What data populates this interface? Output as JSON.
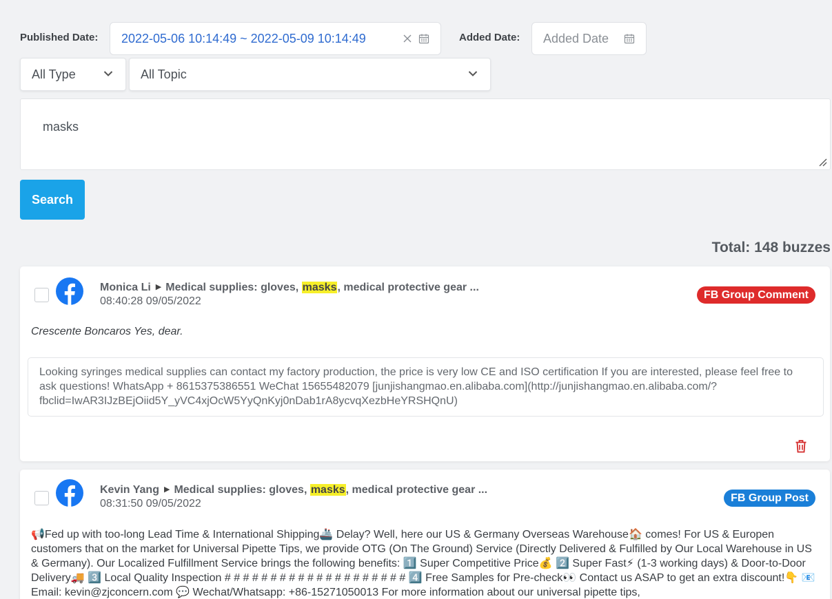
{
  "filters": {
    "published_label": "Published Date:",
    "published_value": "2022-05-06 10:14:49 ~ 2022-05-09 10:14:49",
    "added_label": "Added Date:",
    "added_placeholder": "Added Date",
    "type_value": "All Type",
    "topic_value": "All Topic",
    "search_text": "masks",
    "search_button": "Search"
  },
  "total_text": "Total: 148 buzzes",
  "colors": {
    "accent": "#1aa3e8",
    "fb_blue": "#1877f2",
    "badge_red": "#de2b2b",
    "badge_blue": "#1a7fd8",
    "highlight": "#f6ef2a"
  },
  "buzzes": [
    {
      "icon": "facebook-icon",
      "author": "Monica Li",
      "topic_prefix": "Medical supplies: gloves, ",
      "topic_highlight": "masks",
      "topic_suffix": ", medical protective gear ...",
      "datetime": "08:40:28 09/05/2022",
      "badge": "FB Group Comment",
      "comment": "Crescente Boncaros Yes, dear.",
      "quote": "Looking syringes medical supplies can contact my factory production, the price is very low CE and ISO certification If you are interested, please feel free to ask questions! WhatsApp + 8615375386551 WeChat 15655482079 [junjishangmao.en.alibaba.com](http://junjishangmao.en.alibaba.com/?fbclid=IwAR3IJzBEjOiid5Y_yVC4xjOcW5YyQnKyj0nDab1rA8ycvqXezbHeYRSHQnU)"
    },
    {
      "icon": "facebook-icon",
      "author": "Kevin Yang",
      "topic_prefix": "Medical supplies: gloves, ",
      "topic_highlight": "masks",
      "topic_suffix": ", medical protective gear ...",
      "datetime": "08:31:50 09/05/2022",
      "badge": "FB Group Post",
      "body": "📢Fed up with too-long Lead Time & International Shipping🚢 Delay? Well, here our US & Germany Overseas Warehouse🏠 comes! For US & Europen customers that on the market for Universal Pipette Tips, we provide OTG (On The Ground) Service (Directly Delivered & Fulfilled by Our Local Warehouse in US & Germany). Our Localized Fulfillment Service brings the following benefits: 1️⃣ Super Competitive Price💰 2️⃣ Super Fast⚡ (1-3 working days) & Door-to-Door Delivery🚚 3️⃣ Local Quality Inspection # # # # # # # # # # # # # # # # # # # # 4️⃣ Free Samples for Pre-check👀 Contact us ASAP to get an extra discount!👇 📧 Email: kevin@zjconcern.com 💬 Wechat/Whatsapp: +86-15271050013 For more information about our universal pipette tips,"
    }
  ]
}
